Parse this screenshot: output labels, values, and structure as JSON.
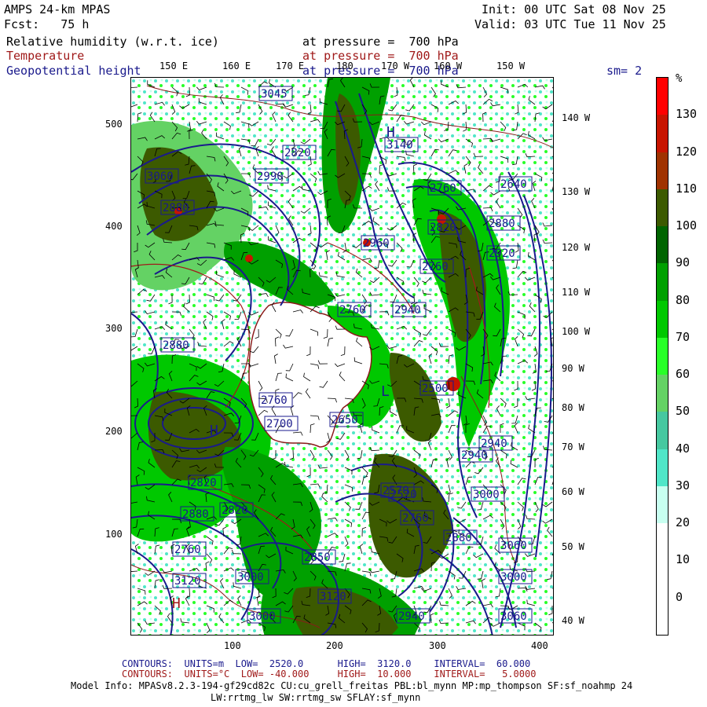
{
  "header": {
    "model": "AMPS 24-km MPAS",
    "fcst": "Fcst:   75 h",
    "init": "Init: 00 UTC Sat 08 Nov 25",
    "valid": "Valid: 03 UTC Tue 11 Nov 25"
  },
  "fields": [
    {
      "name": "Relative humidity (w.r.t. ice)",
      "level": "at pressure =  700 hPa",
      "color": "#000000"
    },
    {
      "name": "Temperature",
      "level": "at pressure =  700 hPa",
      "color": "#a01a1a"
    },
    {
      "name": "Geopotential height",
      "level": "at pressure =  700 hPa",
      "color": "#1a1a8c"
    }
  ],
  "smoothing": "sm= 2",
  "top_lon_labels": [
    "150 E",
    "160 E",
    "170 E",
    "180",
    "170 W",
    "160 W",
    "150 W"
  ],
  "right_lon_labels": [
    "140 W",
    "130 W",
    "120 W",
    "110 W",
    "100 W",
    "90 W",
    "80 W",
    "70 W",
    "60 W",
    "50 W",
    "40 W"
  ],
  "y_ticks": [
    "500",
    "400",
    "300",
    "200",
    "100"
  ],
  "x_ticks": [
    "100",
    "200",
    "300",
    "400"
  ],
  "colorbar": {
    "unit": "%",
    "labels": [
      "130",
      "120",
      "110",
      "100",
      "90",
      "80",
      "70",
      "60",
      "50",
      "40",
      "30",
      "20",
      "10",
      "0"
    ],
    "colors": [
      "#ff0000",
      "#c81400",
      "#a03200",
      "#3c5a00",
      "#006400",
      "#00a000",
      "#00c800",
      "#28ff28",
      "#64d264",
      "#46c8a0",
      "#50e6c8",
      "#c8fff0",
      "#ffffff",
      "#ffffff",
      "#ffffff"
    ]
  },
  "height_labels": [
    "3045",
    "3140",
    "3060",
    "2990",
    "2880",
    "2820",
    "2760",
    "2640",
    "2960",
    "2820",
    "2880",
    "2920",
    "2760",
    "2940",
    "2880",
    "2760",
    "2700",
    "2760",
    "2650",
    "2500",
    "2520",
    "2820",
    "2940",
    "3000",
    "2880",
    "2570",
    "2760",
    "2850",
    "2820",
    "3060",
    "3000",
    "2880",
    "2940",
    "2940",
    "3060",
    "3120",
    "3000",
    "3120",
    "2760",
    "3000"
  ],
  "highs_lows": [
    "H",
    "L",
    "H",
    "H"
  ],
  "footer": {
    "contour1": {
      "label": "CONTOURS:",
      "units": "UNITS=m",
      "low": "LOW=  2520.0",
      "high": "HIGH=  3120.0",
      "interval": "INTERVAL=  60.000"
    },
    "contour2": {
      "label": "CONTOURS:",
      "units": "UNITS=°C",
      "low": "LOW= -40.000",
      "high": "HIGH=  10.000",
      "interval": "INTERVAL=   5.0000"
    },
    "model_info": "Model Info: MPASv8.2.3-194-gf29cd82c CU:cu_grell_freitas PBL:bl_mynn MP:mp_thompson SF:sf_noahmp 24",
    "model_info2": "LW:rrtmg_lw SW:rrtmg_sw SFLAY:sf_mynn"
  }
}
